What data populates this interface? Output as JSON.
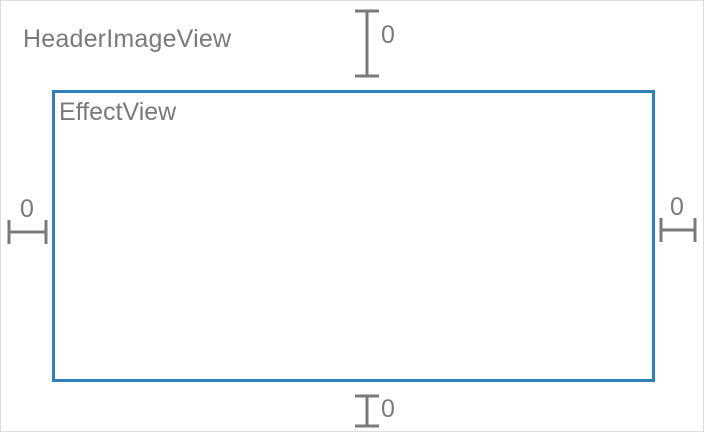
{
  "outer_view": {
    "label": "HeaderImageView"
  },
  "inner_view": {
    "label": "EffectView",
    "border_color": "#2f7fb8"
  },
  "constraints": {
    "top": "0",
    "left": "0",
    "right": "0",
    "bottom": "0",
    "color": "#7a7a7a"
  }
}
